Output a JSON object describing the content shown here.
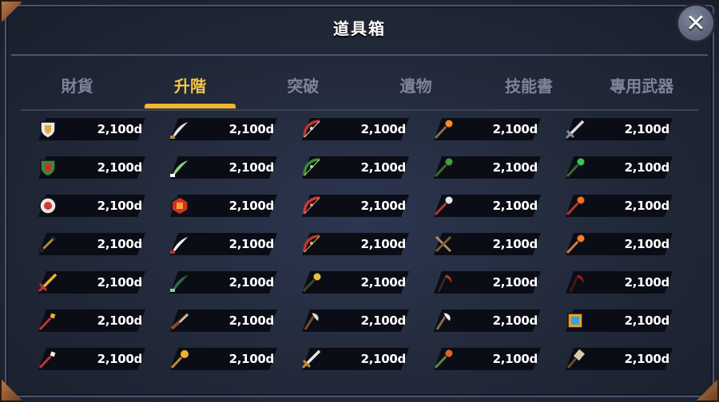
{
  "title": "道具箱",
  "close_label": "✕",
  "tabs": [
    {
      "label": "財貨",
      "active": false
    },
    {
      "label": "升階",
      "active": true
    },
    {
      "label": "突破",
      "active": false
    },
    {
      "label": "遺物",
      "active": false
    },
    {
      "label": "技能書",
      "active": false
    },
    {
      "label": "專用武器",
      "active": false
    }
  ],
  "colors": {
    "accent": "#f2b52e",
    "active_tab_text": "#f4c64a",
    "inactive_tab_text": "#7d8499",
    "price_text": "#ffffff",
    "pill": "#0a0d15"
  },
  "items": [
    {
      "icon": "white-shield-icon",
      "price": "2,100d"
    },
    {
      "icon": "white-curved-blade-icon",
      "price": "2,100d"
    },
    {
      "icon": "red-bow-icon",
      "price": "2,100d"
    },
    {
      "icon": "fire-staff-icon",
      "price": "2,100d"
    },
    {
      "icon": "steel-sword-icon",
      "price": "2,100d"
    },
    {
      "icon": "green-rune-shield-icon",
      "price": "2,100d"
    },
    {
      "icon": "green-feather-blade-icon",
      "price": "2,100d"
    },
    {
      "icon": "green-vine-bow-icon",
      "price": "2,100d"
    },
    {
      "icon": "green-vine-staff-icon",
      "price": "2,100d"
    },
    {
      "icon": "green-orb-staff-icon",
      "price": "2,100d"
    },
    {
      "icon": "red-round-shield-icon",
      "price": "2,100d"
    },
    {
      "icon": "red-gem-shield-icon",
      "price": "2,100d"
    },
    {
      "icon": "red-spiked-bow-icon",
      "price": "2,100d"
    },
    {
      "icon": "silver-staff-icon",
      "price": "2,100d"
    },
    {
      "icon": "flame-staff-icon",
      "price": "2,100d"
    },
    {
      "icon": "chain-flail-icon",
      "price": "2,100d"
    },
    {
      "icon": "white-feather-blade-icon",
      "price": "2,100d"
    },
    {
      "icon": "red-crossbow-icon",
      "price": "2,100d"
    },
    {
      "icon": "crossed-daggers-icon",
      "price": "2,100d"
    },
    {
      "icon": "fire-orb-wand-icon",
      "price": "2,100d"
    },
    {
      "icon": "golden-sword-icon",
      "price": "2,100d"
    },
    {
      "icon": "dark-green-sword-icon",
      "price": "2,100d"
    },
    {
      "icon": "gold-ornate-staff-icon",
      "price": "2,100d"
    },
    {
      "icon": "red-scythe-icon",
      "price": "2,100d"
    },
    {
      "icon": "crimson-scythe-icon",
      "price": "2,100d"
    },
    {
      "icon": "red-spear-icon",
      "price": "2,100d"
    },
    {
      "icon": "wooden-rifle-icon",
      "price": "2,100d"
    },
    {
      "icon": "battle-axe-icon",
      "price": "2,100d"
    },
    {
      "icon": "double-axe-icon",
      "price": "2,100d"
    },
    {
      "icon": "spell-book-icon",
      "price": "2,100d"
    },
    {
      "icon": "spear-tip-icon",
      "price": "2,100d"
    },
    {
      "icon": "golden-mace-icon",
      "price": "2,100d"
    },
    {
      "icon": "broad-sword-icon",
      "price": "2,100d"
    },
    {
      "icon": "jeweled-staff-icon",
      "price": "2,100d"
    },
    {
      "icon": "war-hammer-icon",
      "price": "2,100d"
    }
  ]
}
